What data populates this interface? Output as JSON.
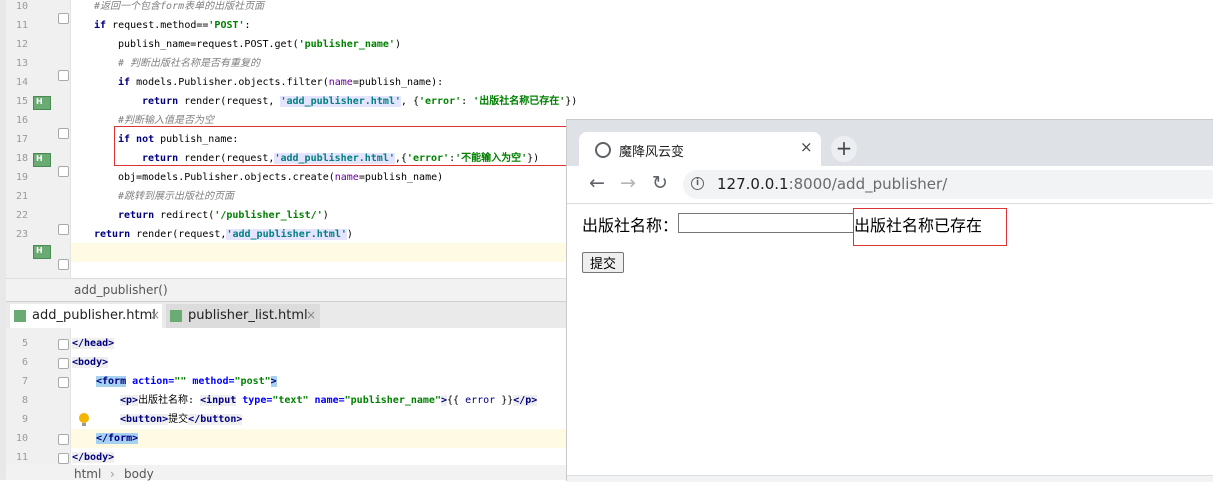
{
  "top_editor": {
    "line_numbers": [
      "10",
      "11",
      "12",
      "13",
      "14",
      "15",
      "16",
      "17",
      "18",
      "19",
      "21",
      "22",
      "23"
    ],
    "lines": [
      {
        "parts": [
          {
            "t": "#返回一个包含",
            "c": "cmt"
          },
          {
            "t": "form",
            "c": "cmt"
          },
          {
            "t": "表单的出版社页面",
            "c": "cmt"
          }
        ]
      },
      {
        "parts": [
          {
            "t": "if",
            "c": "kw"
          },
          {
            "t": " request.method=="
          },
          {
            "t": "'POST'",
            "c": "str"
          },
          {
            "t": ":"
          }
        ]
      },
      {
        "parts": [
          {
            "t": "publish_name=request.POST.get("
          },
          {
            "t": "'publisher_name'",
            "c": "str"
          },
          {
            "t": ")"
          }
        ]
      },
      {
        "parts": [
          {
            "t": "# 判断出版社名称是否有重复的",
            "c": "cmt"
          }
        ]
      },
      {
        "parts": [
          {
            "t": "if",
            "c": "kw"
          },
          {
            "t": " models.Publisher.objects.filter("
          },
          {
            "t": "name",
            "c": "kwarg"
          },
          {
            "t": "=publish_name):"
          }
        ]
      },
      {
        "parts": [
          {
            "t": "return",
            "c": "kw"
          },
          {
            "t": " render(request, "
          },
          {
            "t": "'add_publisher.html'",
            "c": "strh"
          },
          {
            "t": ", {"
          },
          {
            "t": "'error'",
            "c": "str"
          },
          {
            "t": ": "
          },
          {
            "t": "'出版社名称已存在'",
            "c": "str"
          },
          {
            "t": "})"
          }
        ]
      },
      {
        "parts": [
          {
            "t": "#判断输入值是否为空",
            "c": "cmt"
          }
        ]
      },
      {
        "parts": [
          {
            "t": "if not",
            "c": "kw"
          },
          {
            "t": " publish_name:"
          }
        ]
      },
      {
        "parts": [
          {
            "t": "return",
            "c": "kw"
          },
          {
            "t": " render(request,"
          },
          {
            "t": "'add_publisher.html'",
            "c": "strh"
          },
          {
            "t": ",{"
          },
          {
            "t": "'error'",
            "c": "str"
          },
          {
            "t": ":"
          },
          {
            "t": "'不能输入为空'",
            "c": "str"
          },
          {
            "t": "})"
          }
        ]
      },
      {
        "parts": [
          {
            "t": "obj=models.Publisher.objects.create("
          },
          {
            "t": "name",
            "c": "kwarg"
          },
          {
            "t": "=publish_name)"
          }
        ]
      },
      {
        "parts": [
          {
            "t": "#跳转到展示出版社的页面",
            "c": "cmt"
          }
        ]
      },
      {
        "parts": [
          {
            "t": "return",
            "c": "kw"
          },
          {
            "t": " redirect("
          },
          {
            "t": "'/publisher_list/'",
            "c": "str"
          },
          {
            "t": ")"
          }
        ]
      },
      {
        "parts": [
          {
            "t": "return",
            "c": "kw"
          },
          {
            "t": " render(request,"
          },
          {
            "t": "'add_publisher.html'",
            "c": "strh"
          },
          {
            "t": ")"
          }
        ]
      }
    ],
    "breadcrumb": "add_publisher()"
  },
  "editor_tabs": [
    {
      "label": "add_publisher.html",
      "close": "×",
      "active": true
    },
    {
      "label": "publisher_list.html",
      "close": "×",
      "active": false
    }
  ],
  "bottom_editor": {
    "line_numbers": [
      "5",
      "6",
      "7",
      "8",
      "9",
      "10",
      "11"
    ],
    "lines": [
      {
        "parts": [
          {
            "t": "</head>",
            "c": "tag"
          }
        ]
      },
      {
        "parts": [
          {
            "t": "<body>",
            "c": "tag"
          }
        ]
      },
      {
        "parts": [
          {
            "t": "<form",
            "c": "tagh"
          },
          {
            "t": " "
          },
          {
            "t": "action=",
            "c": "attr"
          },
          {
            "t": "\"\"",
            "c": "aval"
          },
          {
            "t": " "
          },
          {
            "t": "method=",
            "c": "attr"
          },
          {
            "t": "\"post\"",
            "c": "aval"
          },
          {
            "t": ">",
            "c": "tagh"
          }
        ]
      },
      {
        "parts": [
          {
            "t": "<p>",
            "c": "tag"
          },
          {
            "t": "出版社名称: "
          },
          {
            "t": "<input",
            "c": "tag"
          },
          {
            "t": " "
          },
          {
            "t": "type=",
            "c": "attr"
          },
          {
            "t": "\"text\"",
            "c": "aval"
          },
          {
            "t": " "
          },
          {
            "t": "name=",
            "c": "attr"
          },
          {
            "t": "\"publisher_name\"",
            "c": "aval"
          },
          {
            "t": ">",
            "c": "tag"
          },
          {
            "t": "{{ "
          },
          {
            "t": "error",
            "c": "tmpl"
          },
          {
            "t": " }}"
          },
          {
            "t": "</p>",
            "c": "tag"
          }
        ]
      },
      {
        "parts": [
          {
            "t": "<button>",
            "c": "tag"
          },
          {
            "t": "提交"
          },
          {
            "t": "</button>",
            "c": "tag"
          }
        ]
      },
      {
        "parts": [
          {
            "t": "</form>",
            "c": "tagh"
          }
        ]
      },
      {
        "parts": [
          {
            "t": "</body>",
            "c": "tag"
          }
        ]
      }
    ],
    "breadcrumb": [
      "html",
      "body"
    ]
  },
  "browser": {
    "tab_title": "魔降风云变",
    "tab_close": "×",
    "new_tab": "+",
    "back": "←",
    "forward": "→",
    "reload": "↻",
    "info": "i",
    "url_host": "127.0.0.1",
    "url_rest": ":8000/add_publisher/",
    "page": {
      "field_label": "出版社名称：",
      "input_value": "",
      "error_text": "出版社名称已存在",
      "submit_label": "提交"
    }
  }
}
